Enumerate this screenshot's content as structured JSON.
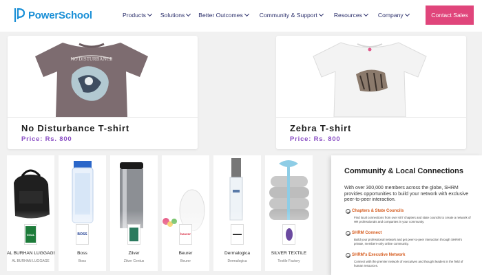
{
  "header": {
    "brand": "PowerSchool",
    "nav": [
      {
        "label": "Products"
      },
      {
        "label": "Solutions"
      },
      {
        "label": "Better Outcomes"
      },
      {
        "label": "Community & Support"
      },
      {
        "label": "Resources"
      },
      {
        "label": "Company"
      }
    ],
    "cta_label": "Contact Sales"
  },
  "products": [
    {
      "name": "No Disturbance T-shirt",
      "price": "Price: Rs. 800",
      "graphic_text": "NO DISTURBANCE"
    },
    {
      "name": "Zebra T-shirt",
      "price": "Price: Rs. 800"
    }
  ],
  "brands": [
    {
      "name": "AL BURHAN LUGGAGE",
      "sub": "AL BURHAN LUGGAGE",
      "logo": "GOAL",
      "logo_color": "#1d7b3a"
    },
    {
      "name": "Boss",
      "sub": "Boss",
      "logo": "BOSS",
      "logo_color": "#1b3a8f"
    },
    {
      "name": "Zilver",
      "sub": "Zilver Centus",
      "logo": "",
      "logo_color": "#2b7a5e"
    },
    {
      "name": "Beurer",
      "sub": "Beurer",
      "logo": "beurer",
      "logo_color": "#d7263d"
    },
    {
      "name": "Dermalogica",
      "sub": "Dermalogica",
      "logo": "",
      "logo_color": "#333333"
    },
    {
      "name": "SILVER TEXTILE",
      "sub": "Textile Factory",
      "logo": "",
      "logo_color": "#6b4aa0"
    }
  ],
  "shrm": {
    "title": "Community & Local Connections",
    "body": "With over 300,000 members across the globe, SHRM provides opportunities to build your network with exclusive peer-to-peer interaction.",
    "items": [
      {
        "title": "Chapters & State Councils",
        "body": "Find local connections from over 607 chapters and state councils to create a network of HR professionals and companies in your community."
      },
      {
        "title": "SHRM Connect",
        "body": "Build your professional network and get peer-to-peer interaction through SHRM's private, members-only online community."
      },
      {
        "title": "SHRM's Executive Network",
        "body": "Connect with the premier network of executives and thought leaders in the field of human resources."
      }
    ]
  },
  "colors": {
    "brand_blue": "#1a8fd6",
    "nav_text": "#2b2f6b",
    "cta_pink": "#e0457b",
    "price_purple": "#8a4fc4",
    "shrm_orange": "#d55a1c"
  }
}
